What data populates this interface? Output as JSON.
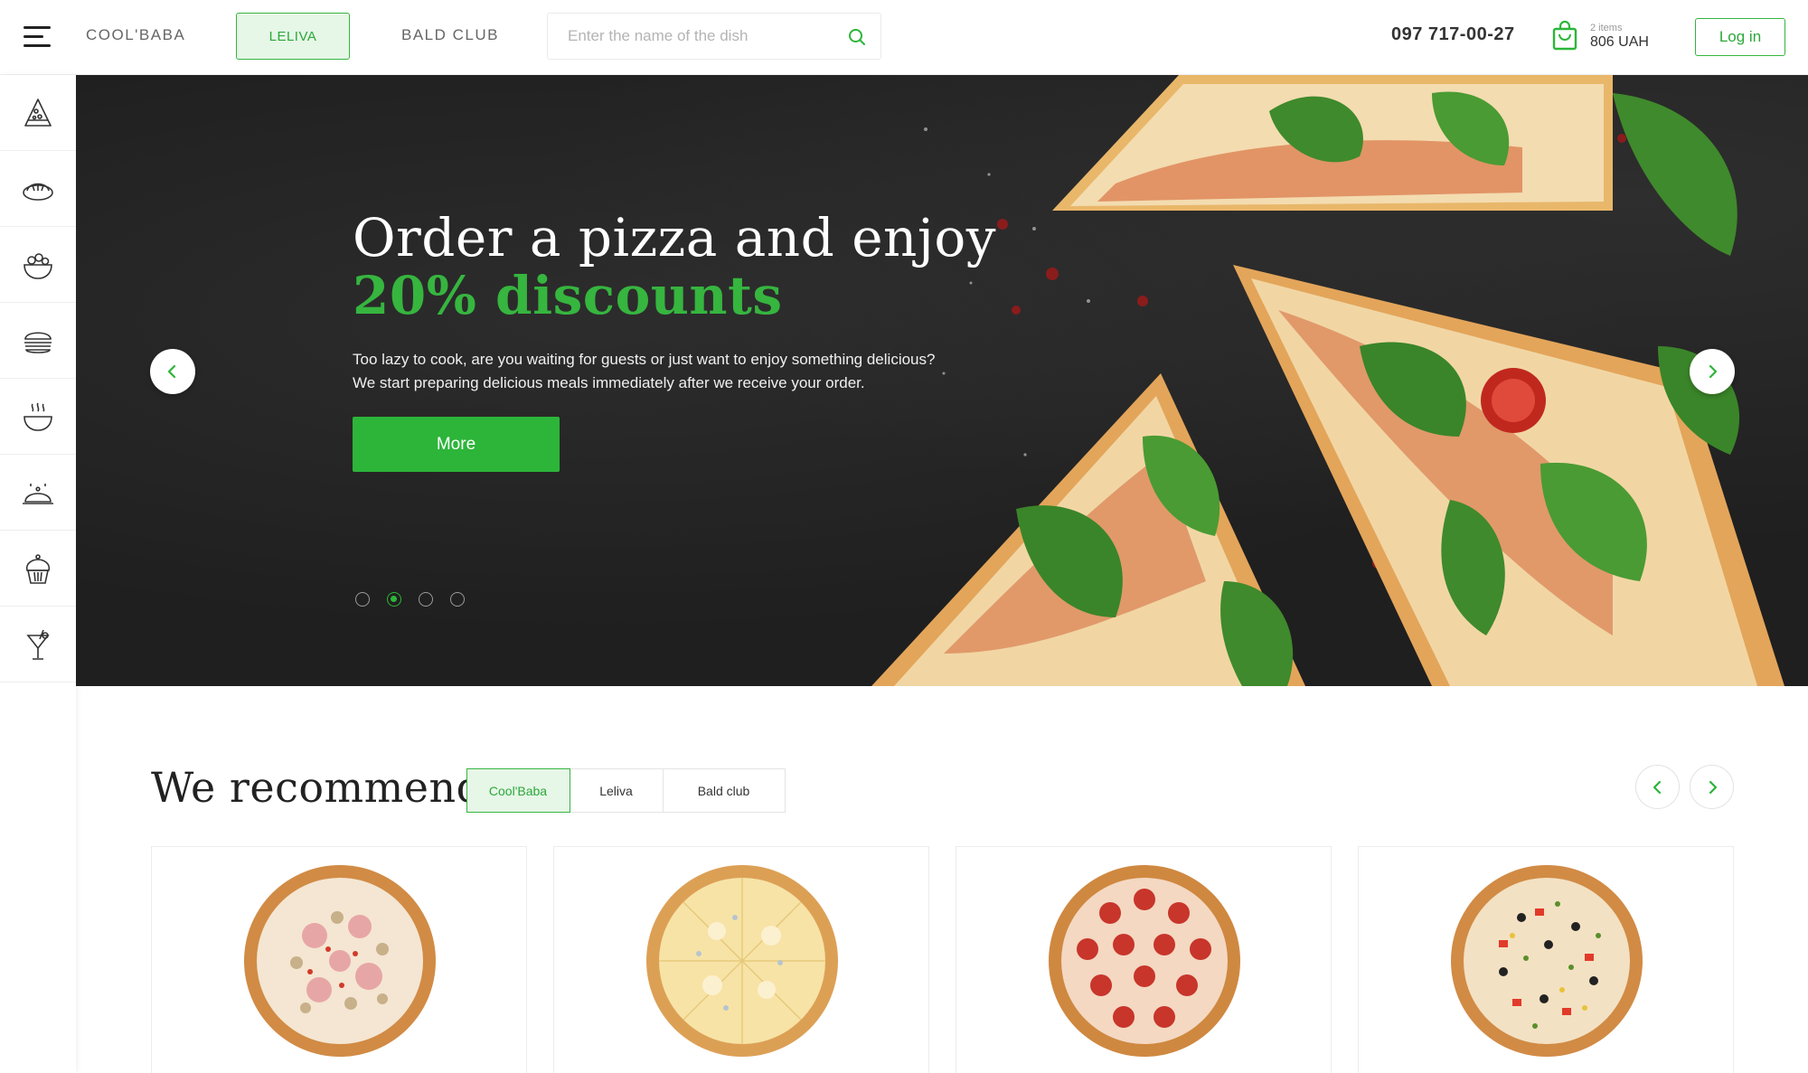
{
  "header": {
    "nav": [
      {
        "label": "COOL'BABA",
        "active": false
      },
      {
        "label": "LELIVA",
        "active": true
      },
      {
        "label": "BALD CLUB",
        "active": false
      }
    ],
    "search": {
      "placeholder": "Enter the name of the dish"
    },
    "phone": "097 717-00-27",
    "cart": {
      "items_label": "2 items",
      "total": "806 UAH"
    },
    "login_label": "Log in"
  },
  "sidebar": {
    "items": [
      {
        "icon": "pizza-icon"
      },
      {
        "icon": "sushi-roll-icon"
      },
      {
        "icon": "salad-icon"
      },
      {
        "icon": "burger-icon"
      },
      {
        "icon": "soup-icon"
      },
      {
        "icon": "hot-dish-icon"
      },
      {
        "icon": "cupcake-icon"
      },
      {
        "icon": "drink-icon"
      }
    ]
  },
  "hero": {
    "title_line1": "Order a pizza and enjoy",
    "title_line2": "20% discounts",
    "text_line1": "Too lazy to cook, are you waiting for guests or just want to enjoy something delicious?",
    "text_line2": "We start preparing delicious meals immediately after we receive your order.",
    "button_label": "More",
    "slides_count": 4,
    "active_slide": 2
  },
  "recommend": {
    "title": "We recommend",
    "tabs": [
      {
        "label": "Cool'Baba",
        "active": true
      },
      {
        "label": "Leliva",
        "active": false
      },
      {
        "label": "Bald club",
        "active": false
      }
    ]
  },
  "products": [
    {
      "image": "ham-mushroom-pizza"
    },
    {
      "image": "four-cheese-pizza"
    },
    {
      "image": "pepperoni-pizza"
    },
    {
      "image": "vegetable-pizza"
    }
  ],
  "colors": {
    "accent": "#2cb539",
    "accent_light": "#e6f6e7",
    "hero_bg": "#1f1f1f",
    "text": "#222222"
  }
}
